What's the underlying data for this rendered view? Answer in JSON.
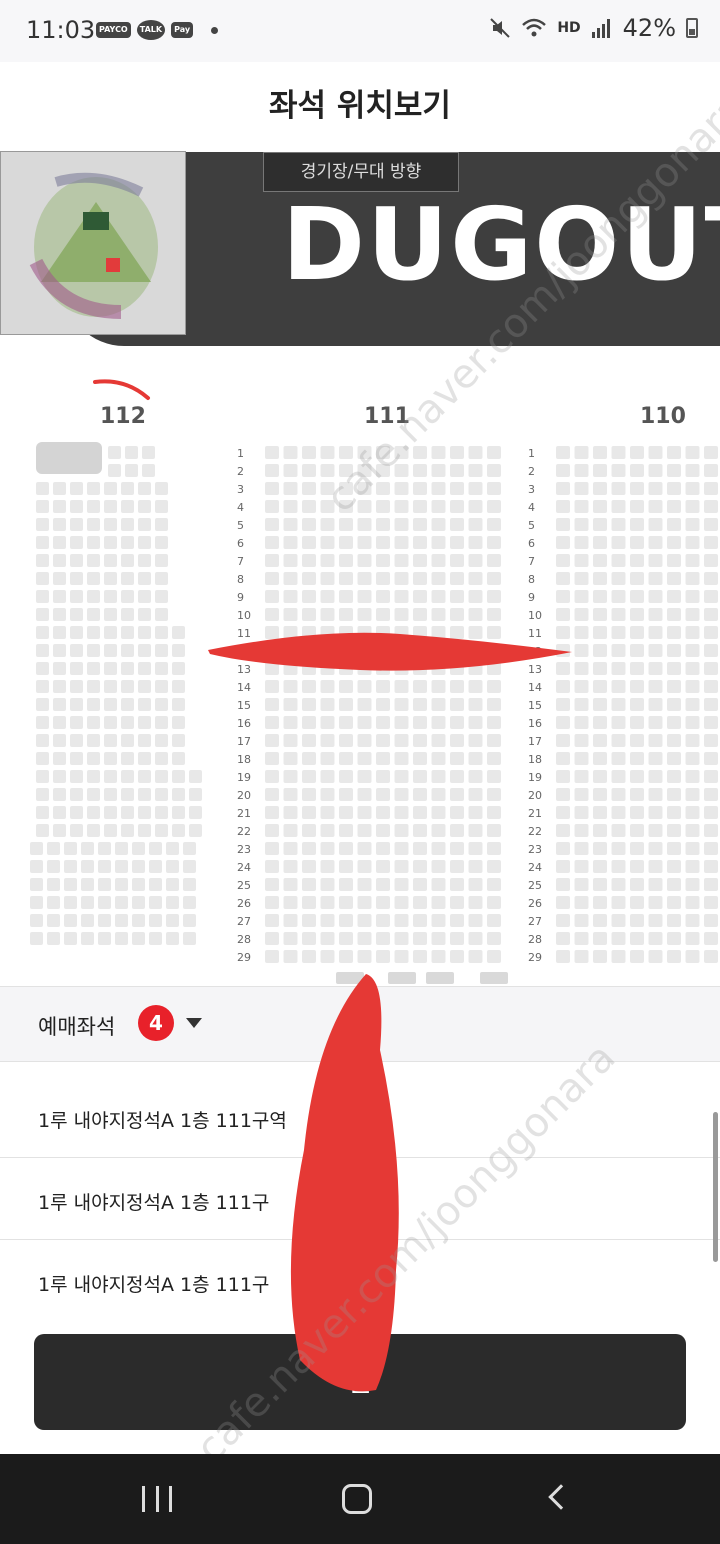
{
  "status_bar": {
    "time": "11:03",
    "app_badges": [
      "PAYCO",
      "TALK",
      "Pay"
    ],
    "network": "HD",
    "battery": "42%"
  },
  "header": {
    "title": "좌석 위치보기"
  },
  "map": {
    "stage_label": "경기장/무대 방향",
    "dugout_text": "DUGOUT",
    "sections": [
      "112",
      "111",
      "110"
    ],
    "row_numbers": [
      "1",
      "2",
      "3",
      "4",
      "5",
      "6",
      "7",
      "8",
      "9",
      "10",
      "11",
      "12",
      "13",
      "14",
      "15",
      "16",
      "17",
      "18",
      "19",
      "20",
      "21",
      "22",
      "23",
      "24",
      "25",
      "26",
      "27",
      "28",
      "29"
    ]
  },
  "reserve": {
    "label": "예매좌석",
    "count": "4"
  },
  "seats": [
    {
      "label": "1루 내야지정석A 1층 111구역"
    },
    {
      "label": "1루 내야지정석A 1층 111구"
    },
    {
      "label": "1루 내야지정석A 1층 111구"
    }
  ],
  "close_button": {
    "label": "닫"
  },
  "watermark": "cafe.naver.com/joonggonara",
  "colors": {
    "accent_red": "#e8212a",
    "button_dark": "#2b2b2b",
    "seat": "#e8e8e8",
    "scribble": "#e53935"
  }
}
